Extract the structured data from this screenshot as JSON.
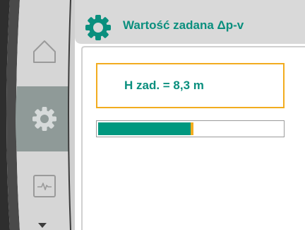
{
  "header": {
    "title": "Wartość zadana Δp-v",
    "icon": "gear-icon"
  },
  "sidebar": {
    "items": [
      {
        "name": "home",
        "icon": "home-icon",
        "active": false
      },
      {
        "name": "settings",
        "icon": "gear-icon",
        "active": true
      },
      {
        "name": "status",
        "icon": "pulse-monitor-icon",
        "active": false
      }
    ],
    "scroll_indicator": "triangle-down-icon"
  },
  "setpoint": {
    "label": "H zad. = 8,3 m"
  },
  "progress": {
    "fraction": 0.5
  },
  "colors": {
    "accent": "#0a8f7e",
    "highlight": "#f2ac1f",
    "sidebar_gray": "#d6d6d6",
    "sidebar_active": "#8f9a98",
    "frame_dark": "#3c3c3c"
  }
}
